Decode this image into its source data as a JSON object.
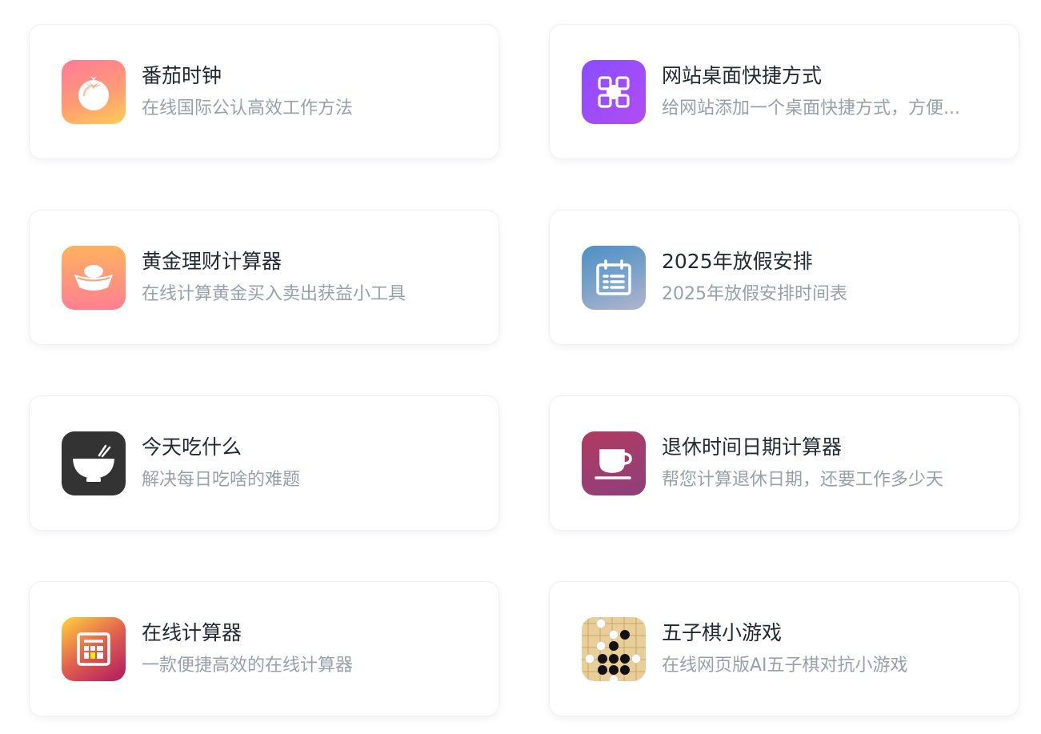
{
  "tools": [
    {
      "title": "番茄时钟",
      "desc": "在线国际公认高效工作方法",
      "icon": "tomato-icon"
    },
    {
      "title": "网站桌面快捷方式",
      "desc": "给网站添加一个桌面快捷方式，方便...",
      "icon": "shortcut-grid-icon"
    },
    {
      "title": "黄金理财计算器",
      "desc": "在线计算黄金买入卖出获益小工具",
      "icon": "gold-ingot-icon"
    },
    {
      "title": "2025年放假安排",
      "desc": "2025年放假安排时间表",
      "icon": "calendar-icon"
    },
    {
      "title": "今天吃什么",
      "desc": "解决每日吃啥的难题",
      "icon": "rice-bowl-icon"
    },
    {
      "title": "退休时间日期计算器",
      "desc": "帮您计算退休日期，还要工作多少天",
      "icon": "coffee-cup-icon"
    },
    {
      "title": "在线计算器",
      "desc": "一款便捷高效的在线计算器",
      "icon": "calculator-icon"
    },
    {
      "title": "五子棋小游戏",
      "desc": "在线网页版AI五子棋对抗小游戏",
      "icon": "gomoku-board-icon"
    }
  ],
  "colors": {
    "title": "#222a33",
    "desc": "#97a1ab",
    "card_border": "#eef0f3"
  }
}
